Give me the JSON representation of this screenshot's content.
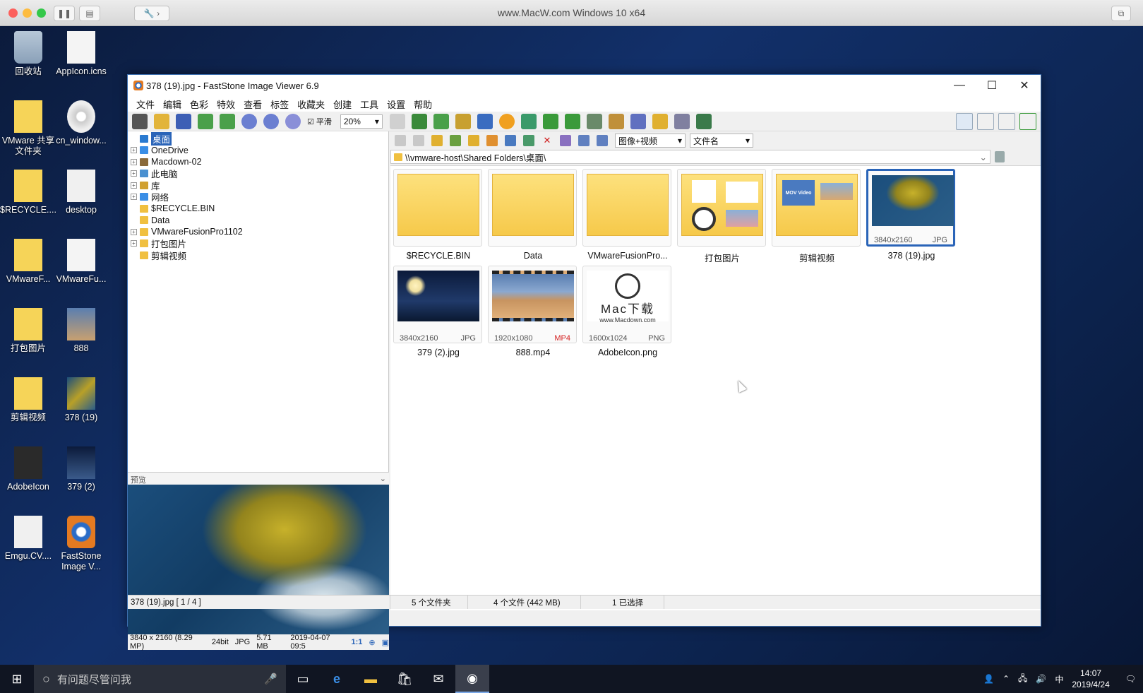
{
  "host": {
    "title": "www.MacW.com   Windows 10 x64"
  },
  "desktop": {
    "icons": [
      {
        "label": "回收站",
        "kind": "recycle"
      },
      {
        "label": "AppIcon.icns",
        "kind": "doc"
      },
      {
        "label": "VMware 共享文件夹",
        "kind": "folder-share"
      },
      {
        "label": "cn_window...",
        "kind": "disc"
      },
      {
        "label": "$RECYCLE....",
        "kind": "folder"
      },
      {
        "label": "desktop",
        "kind": "gear"
      },
      {
        "label": "VMwareF...",
        "kind": "folder"
      },
      {
        "label": "VMwareFu...",
        "kind": "doc"
      },
      {
        "label": "打包图片",
        "kind": "folder-img"
      },
      {
        "label": "888",
        "kind": "video"
      },
      {
        "label": "剪辑视频",
        "kind": "folder-img"
      },
      {
        "label": "378 (19)",
        "kind": "photo"
      },
      {
        "label": "AdobeIcon",
        "kind": "logo"
      },
      {
        "label": "379 (2)",
        "kind": "photo-night"
      },
      {
        "label": "Emgu.CV....",
        "kind": "gear"
      },
      {
        "label": "FastStone Image V...",
        "kind": "app"
      }
    ]
  },
  "window": {
    "title": "378 (19).jpg  -  FastStone Image Viewer 6.9",
    "menu": [
      "文件",
      "编辑",
      "色彩",
      "特效",
      "查看",
      "标签",
      "收藏夹",
      "创建",
      "工具",
      "设置",
      "帮助"
    ],
    "smooth_label": "平滑",
    "zoom": "20%",
    "view_mode": "图像+视频",
    "sort_by": "文件名",
    "address": "\\\\vmware-host\\Shared Folders\\桌面\\"
  },
  "tree": [
    {
      "label": "桌面",
      "expand": "",
      "selected": true
    },
    {
      "label": "OneDrive",
      "expand": "+"
    },
    {
      "label": "Macdown-02",
      "expand": "+"
    },
    {
      "label": "此电脑",
      "expand": "+"
    },
    {
      "label": "库",
      "expand": "+"
    },
    {
      "label": "网络",
      "expand": "+"
    },
    {
      "label": "$RECYCLE.BIN",
      "expand": ""
    },
    {
      "label": "Data",
      "expand": ""
    },
    {
      "label": "VMwareFusionPro1102",
      "expand": "+"
    },
    {
      "label": "打包图片",
      "expand": "+"
    },
    {
      "label": "剪辑视频",
      "expand": ""
    }
  ],
  "preview": {
    "header": "预览",
    "resolution": "3840 x 2160 (8.29 MP)",
    "depth": "24bit",
    "format": "JPG",
    "size": "5.71 MB",
    "date": "2019-04-07 09:5",
    "ratio": "1:1"
  },
  "thumbnails": [
    {
      "name": "$RECYCLE.BIN",
      "type": "folder",
      "dims": "",
      "ext": ""
    },
    {
      "name": "Data",
      "type": "folder",
      "dims": "",
      "ext": ""
    },
    {
      "name": "VMwareFusionPro...",
      "type": "folder",
      "dims": "",
      "ext": ""
    },
    {
      "name": "打包图片",
      "type": "folder-images",
      "dims": "",
      "ext": ""
    },
    {
      "name": "剪辑视频",
      "type": "folder-video",
      "dims": "",
      "ext": "",
      "badge": "MOV Video"
    },
    {
      "name": "378 (19).jpg",
      "type": "photo",
      "dims": "3840x2160",
      "ext": "JPG",
      "selected": true
    },
    {
      "name": "379 (2).jpg",
      "type": "photo-night",
      "dims": "3840x2160",
      "ext": "JPG"
    },
    {
      "name": "888.mp4",
      "type": "video",
      "dims": "1920x1080",
      "ext": "MP4"
    },
    {
      "name": "AdobeIcon.png",
      "type": "logo",
      "dims": "1600x1024",
      "ext": "PNG",
      "logo_text": "Mac下载",
      "logo_url": "www.Macdown.com"
    }
  ],
  "status": {
    "file": "378 (19).jpg [ 1 / 4 ]",
    "folders": "5 个文件夹",
    "files": "4 个文件 (442 MB)",
    "selected": "1 已选择"
  },
  "taskbar": {
    "search_placeholder": "有问题尽管问我",
    "ime": "中",
    "time": "14:07",
    "date": "2019/4/24"
  },
  "colors": {
    "accent": "#2a64b8",
    "mp4": "#d42020"
  }
}
